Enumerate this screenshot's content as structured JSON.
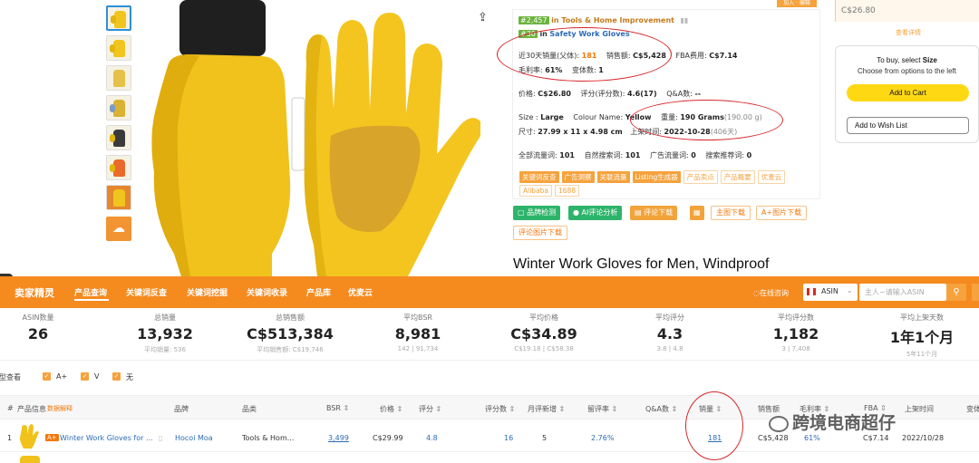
{
  "rank": {
    "main_rank": "#2,457",
    "main_cat": "in Tools & Home Improvement",
    "sub_rank": "#30",
    "sub_cat_prefix": "in",
    "sub_cat": "Safety Work Gloves"
  },
  "metrics": {
    "sales30_label": "近30天销量(父体):",
    "sales30_value": "181",
    "revenue_label": "销售额:",
    "revenue_value": "C$5,428",
    "fba_label": "FBA费用:",
    "fba_value": "C$7.14",
    "margin_label": "毛利率:",
    "margin_value": "61%",
    "variants_label": "变体数:",
    "variants_value": "1",
    "price_label": "价格:",
    "price_value": "C$26.80",
    "rating_label": "评分(评分数):",
    "rating_value": "4.6(17)",
    "qa_label": "Q&A数:",
    "qa_value": "--",
    "size_label": "Size :",
    "size_value": "Large",
    "colour_label": "Colour Name:",
    "colour_value": "Yellow",
    "weight_label": "重量:",
    "weight_value": "190 Grams",
    "weight_g": "(190.00 g)",
    "dims_label": "尺寸:",
    "dims_value": "27.99 x 11 x 4.98 cm",
    "launch_label": "上架时间:",
    "launch_value": "2022-10-28",
    "launch_days": "(406天)",
    "traffic_all_label": "全部流量词:",
    "traffic_all_value": "101",
    "organic_label": "自然搜索词:",
    "organic_value": "101",
    "ad_label": "广告流量词:",
    "ad_value": "0",
    "rec_label": "搜索推荐词:",
    "rec_value": "0"
  },
  "tags": [
    {
      "label": "关键词反查",
      "on": true
    },
    {
      "label": "广告洞察",
      "on": true
    },
    {
      "label": "关联流量",
      "on": true
    },
    {
      "label": "Listing生成器",
      "on": true
    },
    {
      "label": "产品卖点",
      "on": false
    },
    {
      "label": "产品概要",
      "on": false
    },
    {
      "label": "优麦云",
      "on": false
    },
    {
      "label": "Alibaba",
      "on": false
    },
    {
      "label": "1688",
      "on": false
    }
  ],
  "actions": {
    "brand_check": "品牌检测",
    "ai_review": "AI评论分析",
    "review_download": "评论下载",
    "main_img_download": "主图下载",
    "aplus_download": "A+图片下载",
    "review_img_download": "评论图片下载"
  },
  "product_title": "Winter Work Gloves for Men, Windproof",
  "buy_panel": {
    "top_price": "C$26.80",
    "top_link": "查看详情",
    "select_title_prefix": "To buy, select",
    "select_title_bold": "Size",
    "select_sub": "Choose from options to the left",
    "add_cart": "Add to Cart",
    "wish_list": "Add to Wish List"
  },
  "top_right_tab": "加入 · 编辑",
  "nav": {
    "logo": "卖家精灵",
    "items": [
      "产品查询",
      "关键词反查",
      "关键词挖掘",
      "关键词收录",
      "产品库",
      "优麦云"
    ],
    "online": "在线咨询",
    "country": "ASIN",
    "search_placeholder": "主人~请输入ASIN"
  },
  "stats": [
    {
      "label": "ASIN数量",
      "value": "26",
      "sub": ""
    },
    {
      "label": "总销量",
      "value": "13,932",
      "sub": "平均销量: 536"
    },
    {
      "label": "总销售额",
      "value": "C$513,384",
      "sub": "平均销售额: C$19,746"
    },
    {
      "label": "平均BSR",
      "value": "8,981",
      "sub": "142 | 91,734"
    },
    {
      "label": "平均价格",
      "value": "C$34.89",
      "sub": "C$19.18 | C$58.38"
    },
    {
      "label": "平均评分",
      "value": "4.3",
      "sub": "3.8 | 4.8"
    },
    {
      "label": "平均评分数",
      "value": "1,182",
      "sub": "3 | 7,408"
    },
    {
      "label": "平均上架天数",
      "value": "1年1个月",
      "sub": "5年11个月"
    }
  ],
  "filters": {
    "group_label": "类型查看",
    "aplus": "A+",
    "video": "V",
    "none": "无"
  },
  "table": {
    "headers": [
      "#",
      "产品信息",
      "数据解释",
      "品牌",
      "品类",
      "BSR",
      "价格",
      "评分",
      "评分数",
      "月评新增",
      "留评率",
      "Q&A数",
      "销量",
      "销售额",
      "毛利率",
      "FBA",
      "上架时间",
      "变体"
    ],
    "row": {
      "index": "1",
      "aplus_badge": "A+",
      "title": "Winter Work Gloves for ...",
      "brand": "Hocoi Moa",
      "category": "Tools & Hom...",
      "bsr": "3,499",
      "price": "C$29.99",
      "rating": "4.8",
      "ratings": "16",
      "monthly_new": "5",
      "review_rate": "2.76%",
      "qa": "",
      "sales": "181",
      "revenue": "C$5,428",
      "margin": "61%",
      "fba": "C$7.14",
      "launch": "2022/10/28"
    }
  },
  "watermark": "跨境电商超仔",
  "colors": {
    "orange": "#f58a1f",
    "green": "#2db46a",
    "link_blue": "#2c6bb3",
    "red_ring": "#d7262b",
    "cart_yellow": "#ffd814"
  }
}
